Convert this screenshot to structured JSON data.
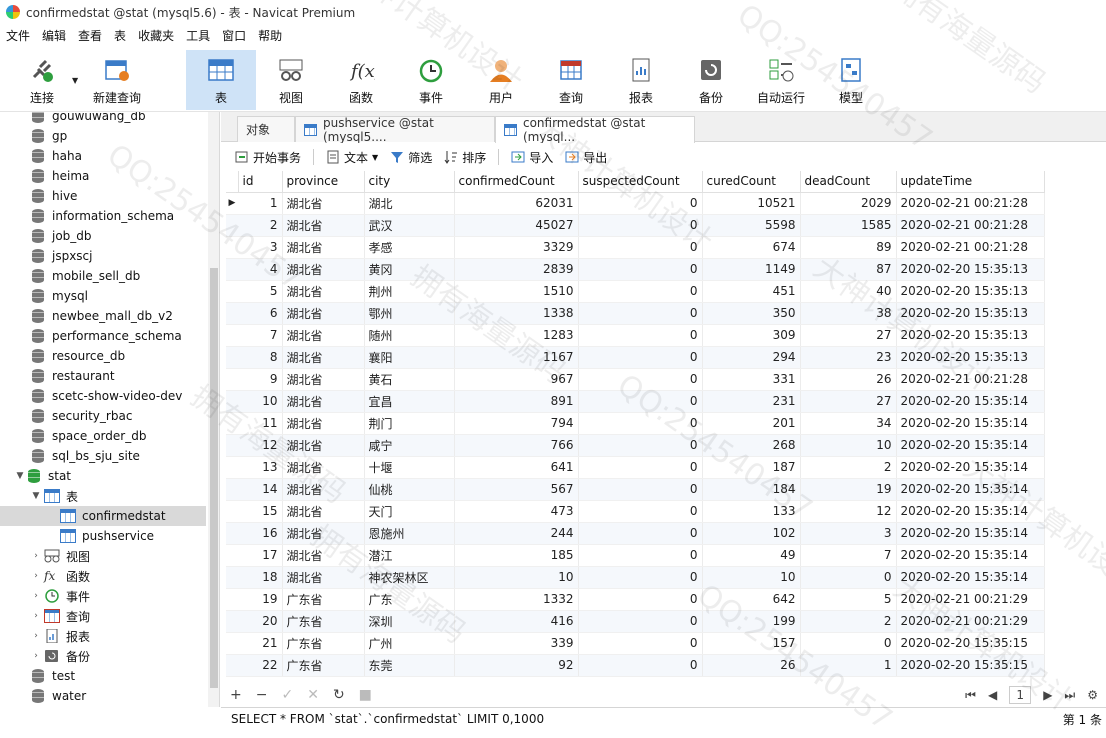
{
  "window": {
    "title": "confirmedstat @stat (mysql5.6) - 表 - Navicat Premium"
  },
  "menu": [
    "文件",
    "编辑",
    "查看",
    "表",
    "收藏夹",
    "工具",
    "窗口",
    "帮助"
  ],
  "toolbar": [
    {
      "label": "连接",
      "icon": "plug-icon"
    },
    {
      "label": "新建查询",
      "icon": "new-query-icon"
    },
    {
      "label": "表",
      "icon": "table-icon"
    },
    {
      "label": "视图",
      "icon": "view-icon"
    },
    {
      "label": "函数",
      "icon": "function-icon"
    },
    {
      "label": "事件",
      "icon": "clock-icon"
    },
    {
      "label": "用户",
      "icon": "user-icon"
    },
    {
      "label": "查询",
      "icon": "query-icon"
    },
    {
      "label": "报表",
      "icon": "report-icon"
    },
    {
      "label": "备份",
      "icon": "backup-icon"
    },
    {
      "label": "自动运行",
      "icon": "schedule-icon"
    },
    {
      "label": "模型",
      "icon": "model-icon"
    }
  ],
  "sidebar": {
    "databases": [
      "gouwuwang_db",
      "gp",
      "haha",
      "heima",
      "hive",
      "information_schema",
      "job_db",
      "jspxscj",
      "mobile_sell_db",
      "mysql",
      "newbee_mall_db_v2",
      "performance_schema",
      "resource_db",
      "restaurant",
      "scetc-show-video-dev",
      "security_rbac",
      "space_order_db",
      "sql_bs_sju_site"
    ],
    "open_db": "stat",
    "tables_group": "表",
    "tables": [
      "confirmedstat",
      "pushservice"
    ],
    "groups": [
      "视图",
      "函数",
      "事件",
      "查询",
      "报表",
      "备份"
    ],
    "after": [
      "test",
      "water"
    ]
  },
  "tabs": [
    "对象",
    "pushservice @stat (mysql5....",
    "confirmedstat @stat (mysql..."
  ],
  "datatoolbar": {
    "begin": "开始事务",
    "text": "文本",
    "filter": "筛选",
    "sort": "排序",
    "import": "导入",
    "export": "导出"
  },
  "grid": {
    "columns": [
      "id",
      "province",
      "city",
      "confirmedCount",
      "suspectedCount",
      "curedCount",
      "deadCount",
      "updateTime"
    ],
    "rows": [
      [
        "1",
        "湖北省",
        "湖北",
        "62031",
        "0",
        "10521",
        "2029",
        "2020-02-21 00:21:28"
      ],
      [
        "2",
        "湖北省",
        "武汉",
        "45027",
        "0",
        "5598",
        "1585",
        "2020-02-21 00:21:28"
      ],
      [
        "3",
        "湖北省",
        "孝感",
        "3329",
        "0",
        "674",
        "89",
        "2020-02-21 00:21:28"
      ],
      [
        "4",
        "湖北省",
        "黄冈",
        "2839",
        "0",
        "1149",
        "87",
        "2020-02-20 15:35:13"
      ],
      [
        "5",
        "湖北省",
        "荆州",
        "1510",
        "0",
        "451",
        "40",
        "2020-02-20 15:35:13"
      ],
      [
        "6",
        "湖北省",
        "鄂州",
        "1338",
        "0",
        "350",
        "38",
        "2020-02-20 15:35:13"
      ],
      [
        "7",
        "湖北省",
        "随州",
        "1283",
        "0",
        "309",
        "27",
        "2020-02-20 15:35:13"
      ],
      [
        "8",
        "湖北省",
        "襄阳",
        "1167",
        "0",
        "294",
        "23",
        "2020-02-20 15:35:13"
      ],
      [
        "9",
        "湖北省",
        "黄石",
        "967",
        "0",
        "331",
        "26",
        "2020-02-21 00:21:28"
      ],
      [
        "10",
        "湖北省",
        "宜昌",
        "891",
        "0",
        "231",
        "27",
        "2020-02-20 15:35:14"
      ],
      [
        "11",
        "湖北省",
        "荆门",
        "794",
        "0",
        "201",
        "34",
        "2020-02-20 15:35:14"
      ],
      [
        "12",
        "湖北省",
        "咸宁",
        "766",
        "0",
        "268",
        "10",
        "2020-02-20 15:35:14"
      ],
      [
        "13",
        "湖北省",
        "十堰",
        "641",
        "0",
        "187",
        "2",
        "2020-02-20 15:35:14"
      ],
      [
        "14",
        "湖北省",
        "仙桃",
        "567",
        "0",
        "184",
        "19",
        "2020-02-20 15:35:14"
      ],
      [
        "15",
        "湖北省",
        "天门",
        "473",
        "0",
        "133",
        "12",
        "2020-02-20 15:35:14"
      ],
      [
        "16",
        "湖北省",
        "恩施州",
        "244",
        "0",
        "102",
        "3",
        "2020-02-20 15:35:14"
      ],
      [
        "17",
        "湖北省",
        "潜江",
        "185",
        "0",
        "49",
        "7",
        "2020-02-20 15:35:14"
      ],
      [
        "18",
        "湖北省",
        "神农架林区",
        "10",
        "0",
        "10",
        "0",
        "2020-02-20 15:35:14"
      ],
      [
        "19",
        "广东省",
        "广东",
        "1332",
        "0",
        "642",
        "5",
        "2020-02-21 00:21:29"
      ],
      [
        "20",
        "广东省",
        "深圳",
        "416",
        "0",
        "199",
        "2",
        "2020-02-21 00:21:29"
      ],
      [
        "21",
        "广东省",
        "广州",
        "339",
        "0",
        "157",
        "0",
        "2020-02-20 15:35:15"
      ],
      [
        "22",
        "广东省",
        "东莞",
        "92",
        "0",
        "26",
        "1",
        "2020-02-20 15:35:15"
      ]
    ]
  },
  "pager": {
    "page": "1"
  },
  "status": {
    "sql": "SELECT * FROM `stat`.`confirmedstat` LIMIT 0,1000",
    "record": "第 1 条"
  },
  "watermarks": [
    "大神计算机设计",
    "QQ:254540457",
    "拥有海量源码"
  ]
}
